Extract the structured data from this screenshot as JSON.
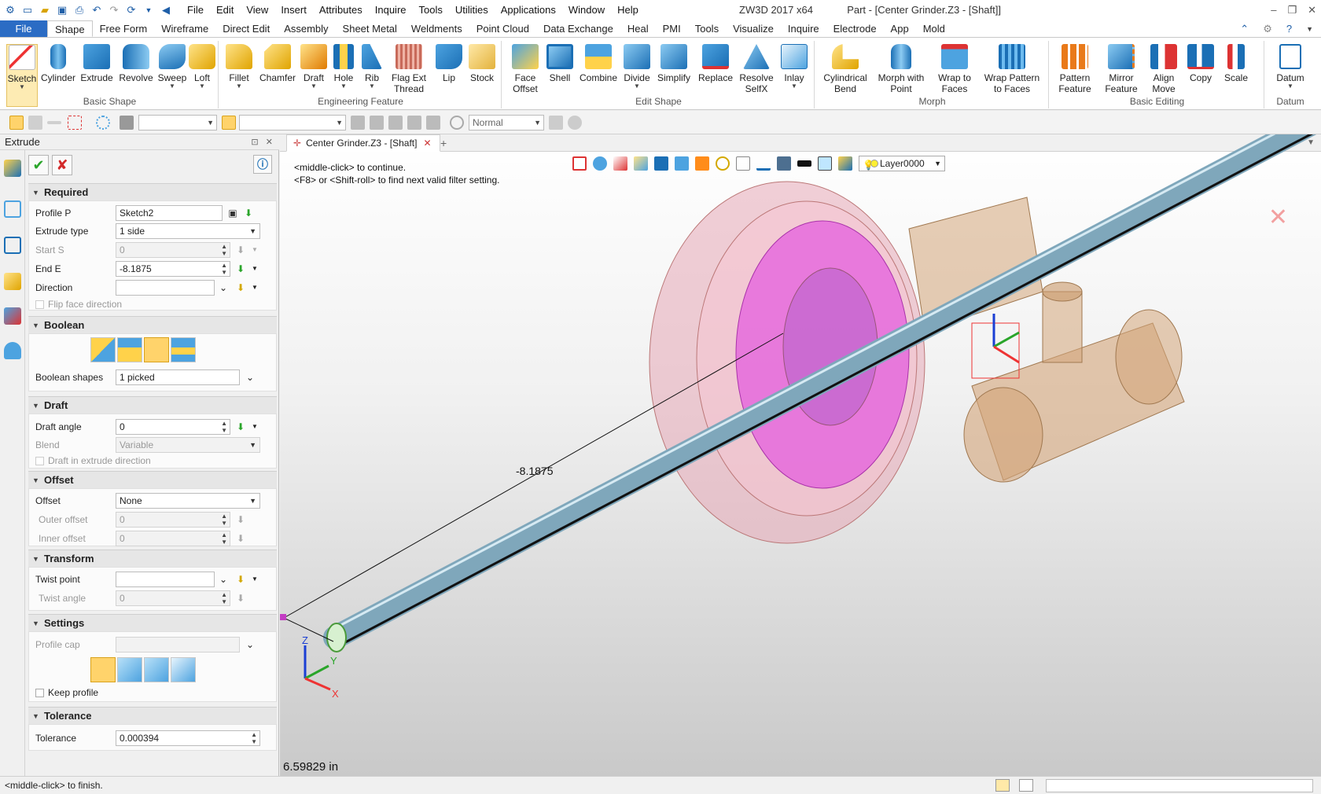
{
  "app": {
    "title": "ZW3D 2017  x64",
    "document": "Part - [Center Grinder.Z3 - [Shaft]]"
  },
  "menu": [
    "File",
    "Edit",
    "View",
    "Insert",
    "Attributes",
    "Inquire",
    "Tools",
    "Utilities",
    "Applications",
    "Window",
    "Help"
  ],
  "ribbon_tabs": [
    "File",
    "Shape",
    "Free Form",
    "Wireframe",
    "Direct Edit",
    "Assembly",
    "Sheet Metal",
    "Weldments",
    "Point Cloud",
    "Data Exchange",
    "Heal",
    "PMI",
    "Tools",
    "Visualize",
    "Inquire",
    "Electrode",
    "App",
    "Mold"
  ],
  "ribbon_active_tab": "Shape",
  "ribbon": {
    "basic_shape": {
      "label": "Basic Shape",
      "buttons": [
        "Sketch",
        "Cylinder",
        "Extrude",
        "Revolve",
        "Sweep",
        "Loft"
      ]
    },
    "engineering_feature": {
      "label": "Engineering Feature",
      "buttons": [
        "Fillet",
        "Chamfer",
        "Draft",
        "Hole",
        "Rib",
        "Flag Ext\nThread",
        "Lip",
        "Stock"
      ]
    },
    "edit_shape": {
      "label": "Edit Shape",
      "buttons": [
        "Face\nOffset",
        "Shell",
        "Combine",
        "Divide",
        "Simplify",
        "Replace",
        "Resolve\nSelfX",
        "Inlay"
      ]
    },
    "morph": {
      "label": "Morph",
      "buttons": [
        "Cylindrical\nBend",
        "Morph with\nPoint",
        "Wrap to\nFaces",
        "Wrap Pattern\nto Faces"
      ]
    },
    "basic_editing": {
      "label": "Basic Editing",
      "buttons": [
        "Pattern\nFeature",
        "Mirror\nFeature",
        "Align\nMove",
        "Copy",
        "Scale"
      ]
    },
    "datum": {
      "label": "Datum",
      "buttons": [
        "Datum"
      ]
    }
  },
  "toolbar2": {
    "render_mode": "Normal"
  },
  "panel": {
    "title": "Extrude",
    "required": {
      "header": "Required",
      "profile_label": "Profile P",
      "profile_value": "Sketch2",
      "extrude_type_label": "Extrude type",
      "extrude_type_value": "1 side",
      "start_label": "Start S",
      "start_value": "0",
      "end_label": "End E",
      "end_value": "-8.1875",
      "direction_label": "Direction",
      "direction_value": "",
      "flip_label": "Flip face direction"
    },
    "boolean": {
      "header": "Boolean",
      "shapes_label": "Boolean shapes",
      "shapes_value": "1 picked"
    },
    "draft": {
      "header": "Draft",
      "angle_label": "Draft angle",
      "angle_value": "0",
      "blend_label": "Blend",
      "blend_value": "Variable",
      "dir_label": "Draft in extrude direction"
    },
    "offset": {
      "header": "Offset",
      "offset_label": "Offset",
      "offset_value": "None",
      "outer_label": "Outer offset",
      "outer_value": "0",
      "inner_label": "Inner offset",
      "inner_value": "0"
    },
    "transform": {
      "header": "Transform",
      "twist_point_label": "Twist point",
      "twist_point_value": "",
      "twist_angle_label": "Twist angle",
      "twist_angle_value": "0"
    },
    "settings": {
      "header": "Settings",
      "cap_label": "Profile cap",
      "cap_value": "",
      "keep_label": "Keep profile"
    },
    "tolerance": {
      "header": "Tolerance",
      "label": "Tolerance",
      "value": "0.000394"
    }
  },
  "viewport": {
    "tab_label": "Center Grinder.Z3 - [Shaft]",
    "layer": "Layer0000",
    "hint_line1": "<middle-click> to continue.",
    "hint_line2": "<F8> or <Shift-roll> to find next valid filter setting.",
    "dimension": "-8.1875",
    "length_readout": "6.59829 in",
    "axis_x": "X",
    "axis_y": "Y",
    "axis_z": "Z"
  },
  "status": {
    "message": "<middle-click> to finish."
  }
}
